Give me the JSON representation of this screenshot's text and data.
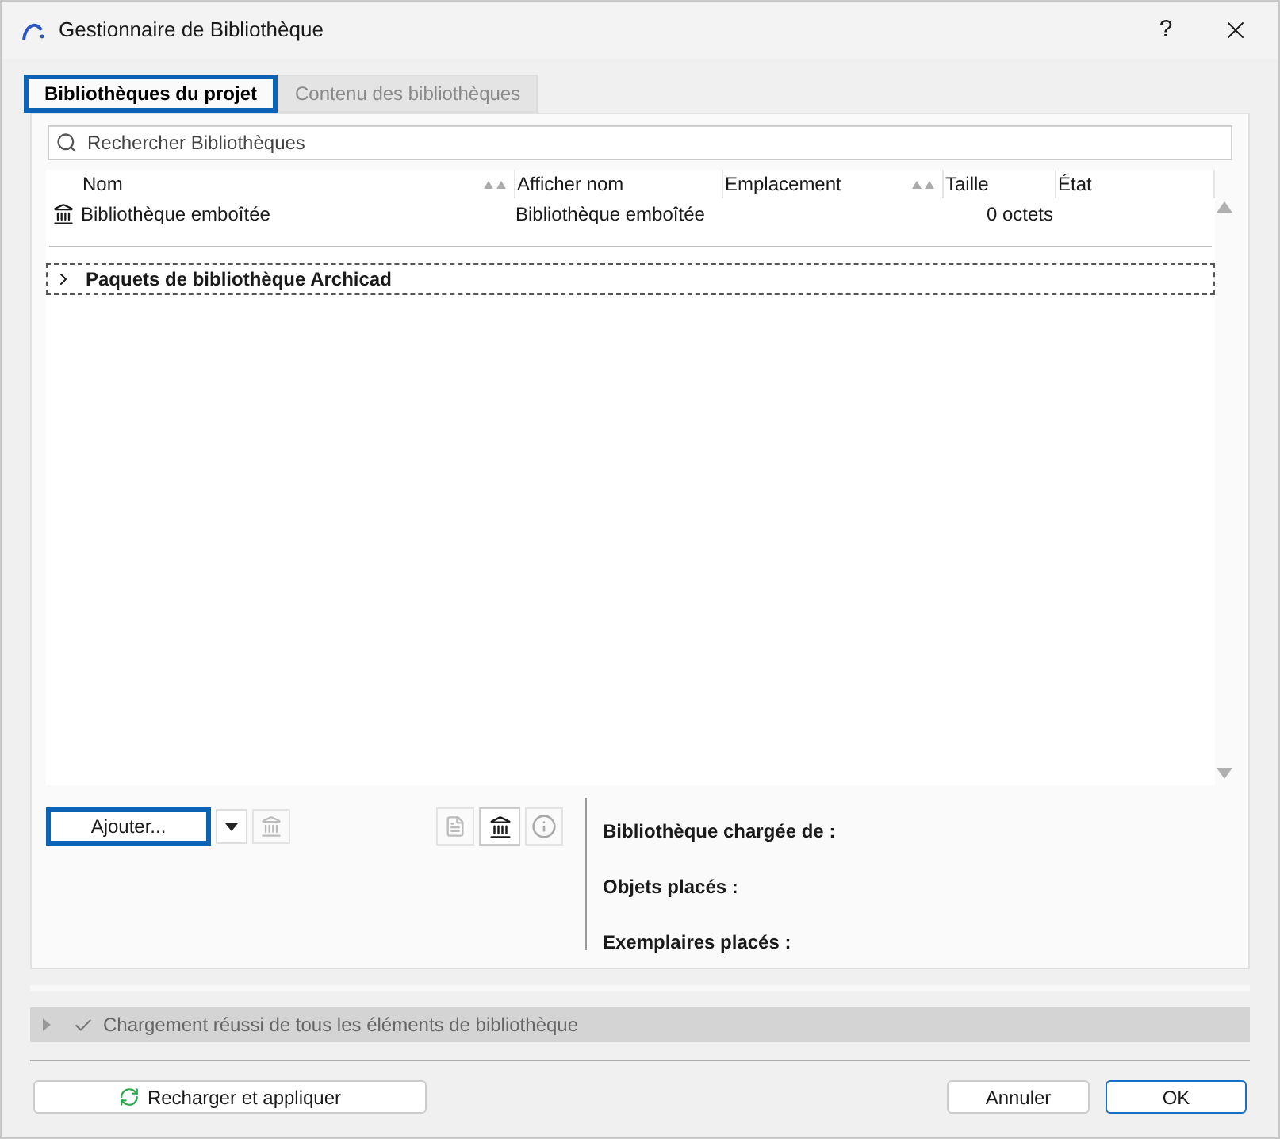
{
  "window": {
    "title": "Gestionnaire de Bibliothèque",
    "help": "?"
  },
  "tabs": [
    {
      "label": "Bibliothèques du projet",
      "selected": true,
      "highlighted": true
    },
    {
      "label": "Contenu des bibliothèques",
      "selected": false,
      "highlighted": false
    }
  ],
  "search": {
    "placeholder": "Rechercher Bibliothèques"
  },
  "table": {
    "columns": [
      {
        "label": "Nom",
        "sorted": true
      },
      {
        "label": "Afficher nom",
        "sorted": false
      },
      {
        "label": "Emplacement",
        "sorted": true
      },
      {
        "label": "Taille",
        "sorted": false
      },
      {
        "label": "État",
        "sorted": false
      }
    ],
    "rows": [
      {
        "cells": [
          "Bibliothèque emboîtée",
          "Bibliothèque emboîtée",
          "",
          "0 octets",
          ""
        ]
      }
    ],
    "groups": [
      {
        "label": "Paquets de bibliothèque Archicad",
        "expanded": false
      }
    ]
  },
  "add_button": {
    "label": "Ajouter...",
    "highlighted": true
  },
  "info": [
    {
      "label": "Bibliothèque chargée de :"
    },
    {
      "label": "Objets placés :"
    },
    {
      "label": "Exemplaires placés :"
    }
  ],
  "status": {
    "text": "Chargement réussi de tous les éléments de bibliothèque",
    "expanded": false
  },
  "buttons": {
    "reload": "Recharger et appliquer",
    "cancel": "Annuler",
    "ok": "OK"
  }
}
